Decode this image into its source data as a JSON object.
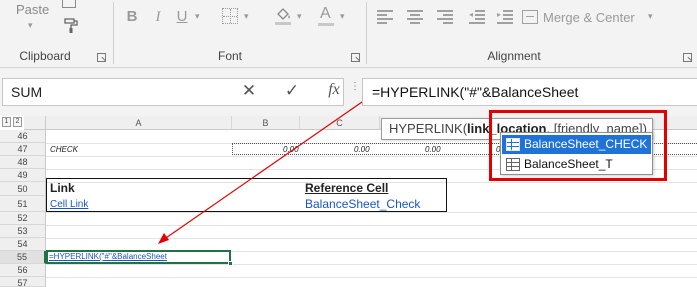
{
  "ribbon": {
    "clipboard": {
      "paste_label": "Paste",
      "group_label": "Clipboard"
    },
    "font": {
      "group_label": "Font",
      "bold": "B",
      "italic": "I",
      "underline": "U",
      "font_color_letter": "A"
    },
    "alignment": {
      "group_label": "Alignment",
      "merge_label": "Merge & Center"
    }
  },
  "formula_bar": {
    "name_box": "SUM",
    "cancel_symbol": "✕",
    "enter_symbol": "✓",
    "fx_symbol": "fx",
    "formula": "=HYPERLINK(\"#\"&BalanceSheet"
  },
  "outline_levels": [
    "1",
    "2"
  ],
  "columns": [
    "A",
    "B",
    "C"
  ],
  "rows": [
    "46",
    "47",
    "48",
    "49",
    "50",
    "51",
    "52",
    "53",
    "54",
    "55",
    "56",
    "57"
  ],
  "cells": {
    "a47": "CHECK",
    "b47": "0.00",
    "c47": "0.00",
    "d47": "0.00",
    "e47": "0.00",
    "a50": "Link",
    "c50": "Reference Cell",
    "a51": "Cell Link",
    "c51": "BalanceSheet_Check",
    "a55": "=HYPERLINK(\"#\"&BalanceSheet"
  },
  "tooltip": {
    "prefix": "HYPERLINK(",
    "arg_bold": "link_location",
    "suffix": ", [friendly_name])"
  },
  "autocomplete": {
    "items": [
      "BalanceSheet_CHECK",
      "BalanceSheet_T"
    ],
    "selected_index": 0
  },
  "colors": {
    "annotation_red": "#e50000",
    "hyperlink_blue": "#1a56c4",
    "selection_blue": "#1f73d8",
    "active_cell_green": "#217346"
  }
}
